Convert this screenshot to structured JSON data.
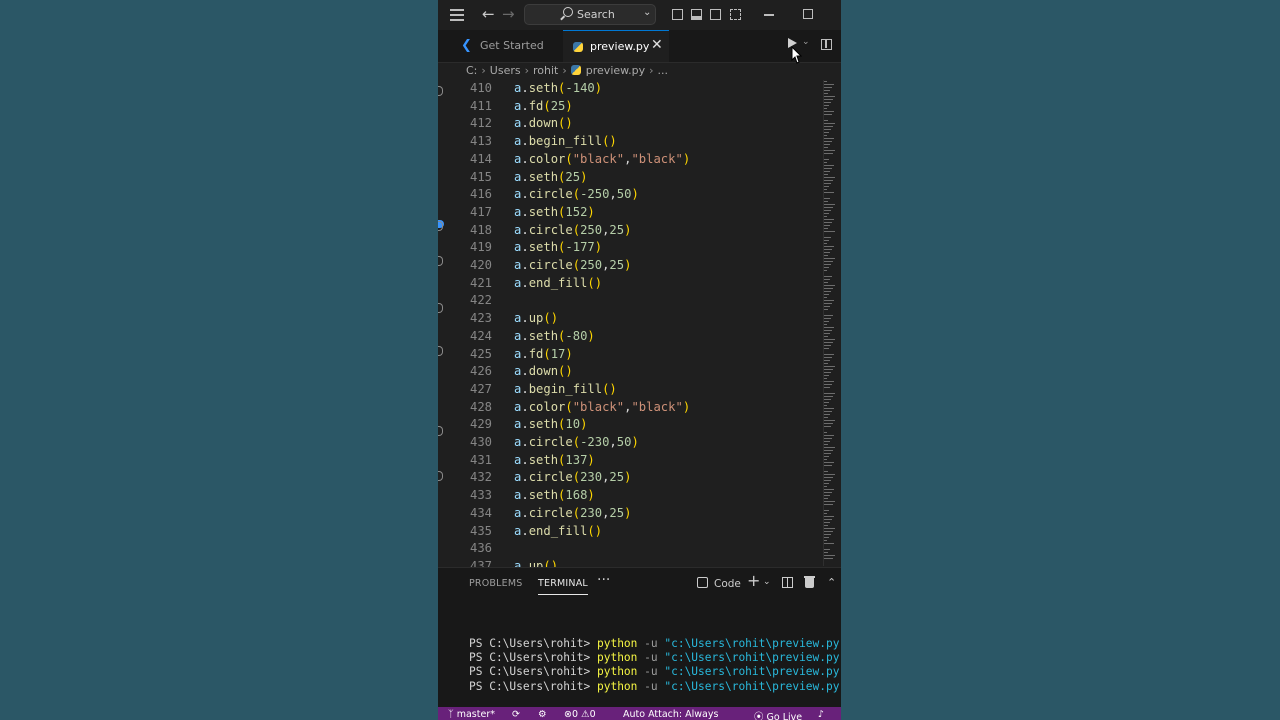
{
  "window": {
    "search_label": "Search"
  },
  "tabs": [
    {
      "label": "Get Started",
      "active": false
    },
    {
      "label": "preview.py",
      "active": true
    }
  ],
  "breadcrumb": [
    "C:",
    "Users",
    "rohit",
    "preview.py",
    "..."
  ],
  "code_lines": [
    {
      "n": "410",
      "tokens": [
        [
          "obj",
          "a"
        ],
        [
          "",
          "."
        ],
        [
          "fn",
          "seth"
        ],
        [
          "p1",
          "("
        ],
        [
          "num",
          "-140"
        ],
        [
          "p1",
          ")"
        ]
      ]
    },
    {
      "n": "411",
      "tokens": [
        [
          "obj",
          "a"
        ],
        [
          "",
          "."
        ],
        [
          "fn",
          "fd"
        ],
        [
          "p1",
          "("
        ],
        [
          "num",
          "25"
        ],
        [
          "p1",
          ")"
        ]
      ]
    },
    {
      "n": "412",
      "tokens": [
        [
          "obj",
          "a"
        ],
        [
          "",
          "."
        ],
        [
          "fn",
          "down"
        ],
        [
          "p1",
          "()"
        ]
      ]
    },
    {
      "n": "413",
      "tokens": [
        [
          "obj",
          "a"
        ],
        [
          "",
          "."
        ],
        [
          "fn",
          "begin_fill"
        ],
        [
          "p1",
          "()"
        ]
      ]
    },
    {
      "n": "414",
      "tokens": [
        [
          "obj",
          "a"
        ],
        [
          "",
          "."
        ],
        [
          "fn",
          "color"
        ],
        [
          "p1",
          "("
        ],
        [
          "str",
          "\"black\""
        ],
        [
          "",
          ","
        ],
        [
          "str",
          "\"black\""
        ],
        [
          "p1",
          ")"
        ]
      ]
    },
    {
      "n": "415",
      "tokens": [
        [
          "obj",
          "a"
        ],
        [
          "",
          "."
        ],
        [
          "fn",
          "seth"
        ],
        [
          "p1",
          "("
        ],
        [
          "num",
          "25"
        ],
        [
          "p1",
          ")"
        ]
      ]
    },
    {
      "n": "416",
      "tokens": [
        [
          "obj",
          "a"
        ],
        [
          "",
          "."
        ],
        [
          "fn",
          "circle"
        ],
        [
          "p1",
          "("
        ],
        [
          "num",
          "-250"
        ],
        [
          "",
          ","
        ],
        [
          "num",
          "50"
        ],
        [
          "p1",
          ")"
        ]
      ]
    },
    {
      "n": "417",
      "tokens": [
        [
          "obj",
          "a"
        ],
        [
          "",
          "."
        ],
        [
          "fn",
          "seth"
        ],
        [
          "p1",
          "("
        ],
        [
          "num",
          "152"
        ],
        [
          "p1",
          ")"
        ]
      ]
    },
    {
      "n": "418",
      "tokens": [
        [
          "obj",
          "a"
        ],
        [
          "",
          "."
        ],
        [
          "fn",
          "circle"
        ],
        [
          "p1",
          "("
        ],
        [
          "num",
          "250"
        ],
        [
          "",
          ","
        ],
        [
          "num",
          "25"
        ],
        [
          "p1",
          ")"
        ]
      ]
    },
    {
      "n": "419",
      "tokens": [
        [
          "obj",
          "a"
        ],
        [
          "",
          "."
        ],
        [
          "fn",
          "seth"
        ],
        [
          "p1",
          "("
        ],
        [
          "num",
          "-177"
        ],
        [
          "p1",
          ")"
        ]
      ]
    },
    {
      "n": "420",
      "tokens": [
        [
          "obj",
          "a"
        ],
        [
          "",
          "."
        ],
        [
          "fn",
          "circle"
        ],
        [
          "p1",
          "("
        ],
        [
          "num",
          "250"
        ],
        [
          "",
          ","
        ],
        [
          "num",
          "25"
        ],
        [
          "p1",
          ")"
        ]
      ]
    },
    {
      "n": "421",
      "tokens": [
        [
          "obj",
          "a"
        ],
        [
          "",
          "."
        ],
        [
          "fn",
          "end_fill"
        ],
        [
          "p1",
          "()"
        ]
      ]
    },
    {
      "n": "422",
      "tokens": []
    },
    {
      "n": "423",
      "tokens": [
        [
          "obj",
          "a"
        ],
        [
          "",
          "."
        ],
        [
          "fn",
          "up"
        ],
        [
          "p1",
          "()"
        ]
      ]
    },
    {
      "n": "424",
      "tokens": [
        [
          "obj",
          "a"
        ],
        [
          "",
          "."
        ],
        [
          "fn",
          "seth"
        ],
        [
          "p1",
          "("
        ],
        [
          "num",
          "-80"
        ],
        [
          "p1",
          ")"
        ]
      ]
    },
    {
      "n": "425",
      "tokens": [
        [
          "obj",
          "a"
        ],
        [
          "",
          "."
        ],
        [
          "fn",
          "fd"
        ],
        [
          "p1",
          "("
        ],
        [
          "num",
          "17"
        ],
        [
          "p1",
          ")"
        ]
      ]
    },
    {
      "n": "426",
      "tokens": [
        [
          "obj",
          "a"
        ],
        [
          "",
          "."
        ],
        [
          "fn",
          "down"
        ],
        [
          "p1",
          "()"
        ]
      ]
    },
    {
      "n": "427",
      "tokens": [
        [
          "obj",
          "a"
        ],
        [
          "",
          "."
        ],
        [
          "fn",
          "begin_fill"
        ],
        [
          "p1",
          "()"
        ]
      ]
    },
    {
      "n": "428",
      "tokens": [
        [
          "obj",
          "a"
        ],
        [
          "",
          "."
        ],
        [
          "fn",
          "color"
        ],
        [
          "p1",
          "("
        ],
        [
          "str",
          "\"black\""
        ],
        [
          "",
          ","
        ],
        [
          "str",
          "\"black\""
        ],
        [
          "p1",
          ")"
        ]
      ]
    },
    {
      "n": "429",
      "tokens": [
        [
          "obj",
          "a"
        ],
        [
          "",
          "."
        ],
        [
          "fn",
          "seth"
        ],
        [
          "p1",
          "("
        ],
        [
          "num",
          "10"
        ],
        [
          "p1",
          ")"
        ]
      ]
    },
    {
      "n": "430",
      "tokens": [
        [
          "obj",
          "a"
        ],
        [
          "",
          "."
        ],
        [
          "fn",
          "circle"
        ],
        [
          "p1",
          "("
        ],
        [
          "num",
          "-230"
        ],
        [
          "",
          ","
        ],
        [
          "num",
          "50"
        ],
        [
          "p1",
          ")"
        ]
      ]
    },
    {
      "n": "431",
      "tokens": [
        [
          "obj",
          "a"
        ],
        [
          "",
          "."
        ],
        [
          "fn",
          "seth"
        ],
        [
          "p1",
          "("
        ],
        [
          "num",
          "137"
        ],
        [
          "p1",
          ")"
        ]
      ]
    },
    {
      "n": "432",
      "tokens": [
        [
          "obj",
          "a"
        ],
        [
          "",
          "."
        ],
        [
          "fn",
          "circle"
        ],
        [
          "p1",
          "("
        ],
        [
          "num",
          "230"
        ],
        [
          "",
          ","
        ],
        [
          "num",
          "25"
        ],
        [
          "p1",
          ")"
        ]
      ]
    },
    {
      "n": "433",
      "tokens": [
        [
          "obj",
          "a"
        ],
        [
          "",
          "."
        ],
        [
          "fn",
          "seth"
        ],
        [
          "p1",
          "("
        ],
        [
          "num",
          "168"
        ],
        [
          "p1",
          ")"
        ]
      ]
    },
    {
      "n": "434",
      "tokens": [
        [
          "obj",
          "a"
        ],
        [
          "",
          "."
        ],
        [
          "fn",
          "circle"
        ],
        [
          "p1",
          "("
        ],
        [
          "num",
          "230"
        ],
        [
          "",
          ","
        ],
        [
          "num",
          "25"
        ],
        [
          "p1",
          ")"
        ]
      ]
    },
    {
      "n": "435",
      "tokens": [
        [
          "obj",
          "a"
        ],
        [
          "",
          "."
        ],
        [
          "fn",
          "end_fill"
        ],
        [
          "p1",
          "()"
        ]
      ]
    },
    {
      "n": "436",
      "tokens": []
    },
    {
      "n": "437",
      "tokens": [
        [
          "obj",
          "a"
        ],
        [
          "",
          "."
        ],
        [
          "fn",
          "up"
        ],
        [
          "p1",
          "()"
        ]
      ]
    }
  ],
  "panel": {
    "problems_label": "PROBLEMS",
    "terminal_label": "TERMINAL",
    "more_label": "···",
    "shell_label": "Code"
  },
  "terminal_lines": [
    {
      "prompt": "PS C:\\Users\\rohit> ",
      "cmd": "python",
      "flag": " -u ",
      "path": "\"c:\\Users\\rohit\\preview.py\""
    },
    {
      "prompt": "PS C:\\Users\\rohit> ",
      "cmd": "python",
      "flag": " -u ",
      "path": "\"c:\\Users\\rohit\\preview.py\""
    },
    {
      "prompt": "PS C:\\Users\\rohit> ",
      "cmd": "python",
      "flag": " -u ",
      "path": "\"c:\\Users\\rohit\\preview.py\""
    },
    {
      "prompt": "PS C:\\Users\\rohit> ",
      "cmd": "python",
      "flag": " -u ",
      "path": "\"c:\\Users\\rohit\\preview.py\""
    }
  ],
  "statusbar": {
    "branch": "master*",
    "errors": "0",
    "warnings": "0",
    "auto_attach": "Auto Attach: Always",
    "go_live": "Go Live"
  },
  "colors": {
    "background": "#2b5766",
    "editor": "#1f1f1f",
    "statusbar": "#68217a",
    "accent": "#0078d4"
  }
}
